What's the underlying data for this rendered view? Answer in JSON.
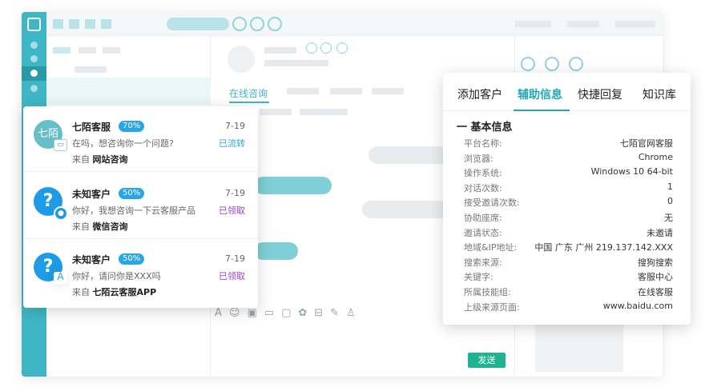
{
  "composer": {
    "send_label": "发送"
  },
  "chat": {
    "tab_online": "在线咨询"
  },
  "conversations": [
    {
      "avatar_text": "七陌",
      "name": "七陌客服",
      "percent": "70%",
      "date": "7-19",
      "message": "在吗，想咨询你一个问题?",
      "status": "已流转",
      "status_color": "#2aa6e6",
      "source_prefix": "来自",
      "source": "网站咨询"
    },
    {
      "avatar_text": "?",
      "name": "未知客户",
      "percent": "50%",
      "date": "7-19",
      "message": "你好，我想咨询一下云客服产品",
      "status": "已领取",
      "status_color": "#9b3fd9",
      "source_prefix": "来自",
      "source": "微信咨询"
    },
    {
      "avatar_text": "?",
      "name": "未知客户",
      "percent": "50%",
      "date": "7-19",
      "message": "你好，请问你是XXX吗",
      "status": "已领取",
      "status_color": "#9b3fd9",
      "source_prefix": "来自",
      "source": "七陌云客服APP"
    }
  ],
  "info_panel": {
    "tabs": [
      "添加客户",
      "辅助信息",
      "快捷回复",
      "知识库"
    ],
    "active_tab": "辅助信息",
    "section_title": "一 基本信息",
    "rows": [
      {
        "key": "平台名称:",
        "value": "七陌官网客服"
      },
      {
        "key": "浏览器:",
        "value": "Chrome"
      },
      {
        "key": "操作系统:",
        "value": "Windows 10 64-bit"
      },
      {
        "key": "对话次数:",
        "value": "1"
      },
      {
        "key": "接受邀请次数:",
        "value": "0"
      },
      {
        "key": "协助座席:",
        "value": "无"
      },
      {
        "key": "邀请状态:",
        "value": "未邀请"
      },
      {
        "key": "地域&IP地址:",
        "value": "中国 广东 广州 219.137.142.XXX"
      },
      {
        "key": "搜索来源:",
        "value": "搜狗搜索"
      },
      {
        "key": "关键字:",
        "value": "客服中心"
      },
      {
        "key": "所属技能组:",
        "value": "在线客服"
      },
      {
        "key": "上级来源页面:",
        "value": "www.baidu.com"
      }
    ]
  },
  "colors": {
    "accent": "#3fb6c6",
    "send": "#1fb48f",
    "badge": "#2aa6e6"
  }
}
